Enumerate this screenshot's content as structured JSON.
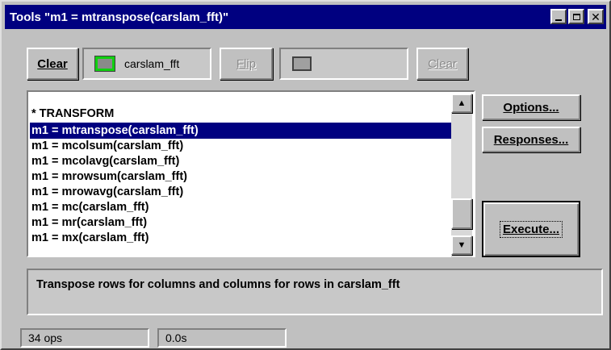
{
  "window": {
    "title": "Tools \"m1 = mtranspose(carslam_fft)\""
  },
  "toolbar": {
    "clear_left_label": "Clear",
    "source_name": "carslam_fft",
    "flip_label": "Flip",
    "clear_right_label": "Clear"
  },
  "list": {
    "header": "* TRANSFORM",
    "items": [
      "m1 = mtranspose(carslam_fft)",
      "m1 = mcolsum(carslam_fft)",
      "m1 = mcolavg(carslam_fft)",
      "m1 = mrowsum(carslam_fft)",
      "m1 = mrowavg(carslam_fft)",
      "m1 = mc(carslam_fft)",
      "m1 = mr(carslam_fft)",
      "m1 = mx(carslam_fft)"
    ],
    "selected_index": 0
  },
  "side_buttons": {
    "options_label": "Options...",
    "responses_label": "Responses...",
    "execute_label": "Execute..."
  },
  "description": "Transpose rows for columns and columns for rows in carslam_fft",
  "status": {
    "ops": "34 ops",
    "time": "0.0s"
  },
  "icons": {
    "minimize": "minimize-icon",
    "maximize": "maximize-icon",
    "close": "close-icon",
    "scroll_up": "arrow-up-icon",
    "scroll_down": "arrow-down-icon"
  }
}
